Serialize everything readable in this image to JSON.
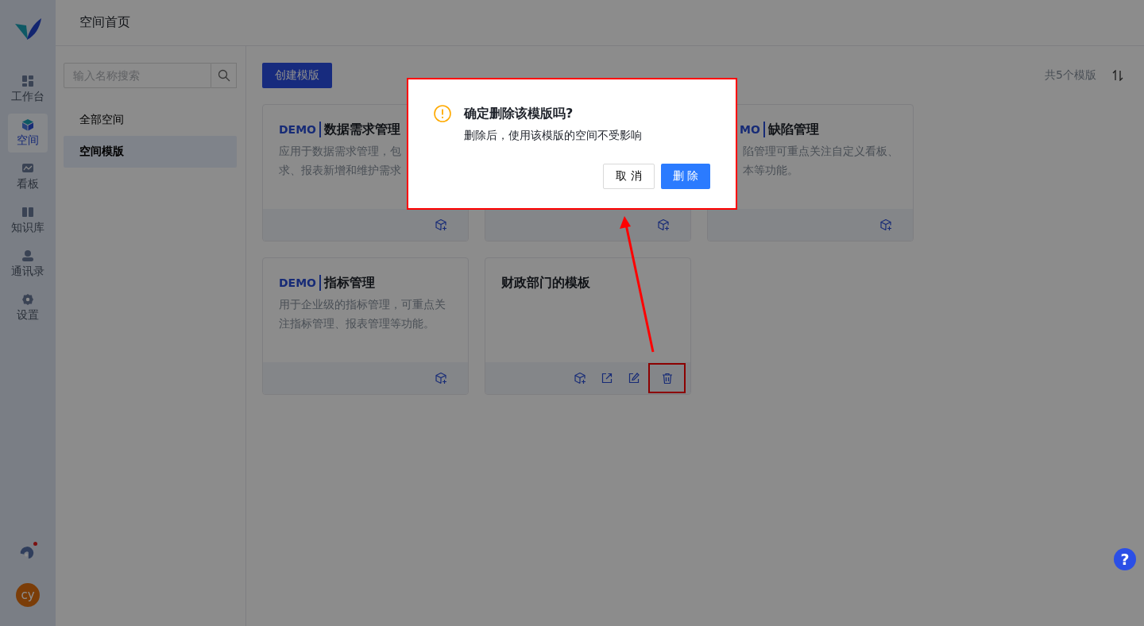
{
  "sidebar": {
    "nav": [
      {
        "label": "工作台",
        "selected": false
      },
      {
        "label": "空间",
        "selected": true
      },
      {
        "label": "看板",
        "selected": false
      },
      {
        "label": "知识库",
        "selected": false
      },
      {
        "label": "通讯录",
        "selected": false
      },
      {
        "label": "设置",
        "selected": false
      }
    ],
    "notification_dot": true,
    "avatar": "cy"
  },
  "header": {
    "title": "空间首页"
  },
  "left_panel": {
    "search": {
      "placeholder": "输入名称搜索"
    },
    "items": [
      {
        "label": "全部空间",
        "selected": false
      },
      {
        "label": "空间模版",
        "selected": true
      }
    ]
  },
  "toolbar": {
    "create_button": "创建模版",
    "count": "共5个模版"
  },
  "cards": [
    {
      "tag": "DEMO",
      "title": "数据需求管理",
      "description": [
        "应用于数据需求管理，包",
        "求、报表新增和维护需求"
      ],
      "cut_left": false,
      "actions": [
        {
          "kind": "add",
          "highlighted": false
        }
      ]
    },
    {
      "actions": [
        {
          "kind": "add",
          "highlighted": false
        }
      ]
    },
    {
      "tag": "MO",
      "title": "缺陷管理",
      "description": [
        "陷管理可重点关注自定义看板、",
        "本等功能。"
      ],
      "cut_left": true,
      "actions": [
        {
          "kind": "add",
          "highlighted": false
        }
      ]
    },
    {
      "tag": "DEMO",
      "title": "指标管理",
      "description": [
        "用于企业级的指标管理，可重点关",
        "注指标管理、报表管理等功能。"
      ],
      "cut_left": false,
      "actions": [
        {
          "kind": "add",
          "highlighted": false
        }
      ]
    },
    {
      "title": "财政部门的模板",
      "cut_left": false,
      "actions": [
        {
          "kind": "add",
          "highlighted": false
        },
        {
          "kind": "share",
          "highlighted": false
        },
        {
          "kind": "edit",
          "highlighted": false
        },
        {
          "kind": "delete",
          "highlighted": true
        }
      ]
    }
  ],
  "dialog": {
    "title": "确定删除该模版吗?",
    "message": "删除后，使用该模版的空间不受影响",
    "cancel": "取 消",
    "confirm": "删 除",
    "highlighted": true
  },
  "annotation_arrow": true,
  "help_button": "?"
}
